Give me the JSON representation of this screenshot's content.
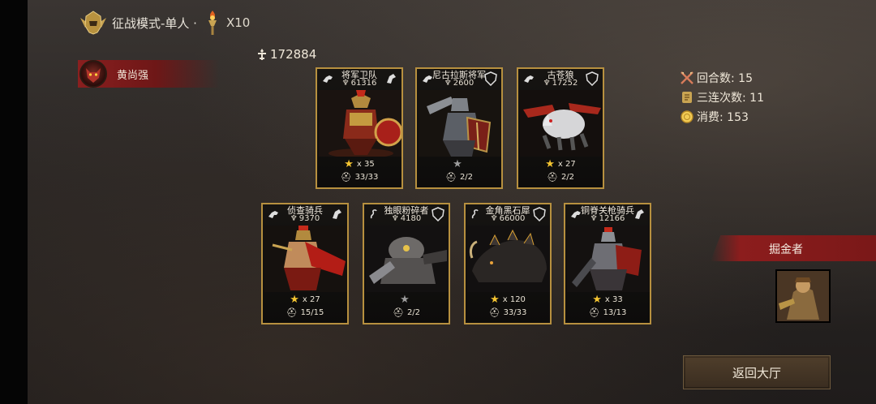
{
  "header": {
    "mode_label": "征战模式-单人 ·",
    "multiplier": "X10",
    "helmet_icon": "golden-helmet-icon",
    "torch_icon": "torch-icon"
  },
  "player": {
    "name": "黄尚强",
    "avatar_icon": "demon-avatar-icon"
  },
  "total_power": "172884",
  "cards_row1": [
    {
      "name": "将军卫队",
      "power": "61316",
      "stars": "x 35",
      "star_color": "gold",
      "troops": "33/33",
      "art": "spartan-warrior"
    },
    {
      "name": "尼古拉斯将军",
      "power": "2600",
      "stars": "",
      "star_color": "gray",
      "troops": "2/2",
      "art": "armored-knight"
    },
    {
      "name": "古苍狼",
      "power": "17252",
      "stars": "x 27",
      "star_color": "gold",
      "troops": "2/2",
      "art": "white-wolf"
    }
  ],
  "cards_row2": [
    {
      "name": "侦查骑兵",
      "power": "9370",
      "stars": "x 27",
      "star_color": "gold",
      "troops": "15/15",
      "art": "roman-scout"
    },
    {
      "name": "独眼粉碎者",
      "power": "4180",
      "stars": "",
      "star_color": "gray",
      "troops": "2/2",
      "art": "cyclops"
    },
    {
      "name": "金角黑石犀",
      "power": "66000",
      "stars": "x 120",
      "star_color": "gold",
      "troops": "33/33",
      "art": "rock-rhino"
    },
    {
      "name": "铜脊关枪骑兵",
      "power": "12166",
      "stars": "x 33",
      "star_color": "gold",
      "troops": "13/13",
      "art": "lancer"
    }
  ],
  "stats": {
    "rounds": "回合数: 15",
    "triple_combo": "三连次数: 11",
    "cost": "消费: 153"
  },
  "enemy": {
    "label": "掘金者",
    "avatar_icon": "gold-digger-avatar-icon"
  },
  "back_button": "返回大厅",
  "colors": {
    "gold": "#b7903f",
    "red_banner": "#8c1d1d",
    "star": "#f5c531"
  }
}
